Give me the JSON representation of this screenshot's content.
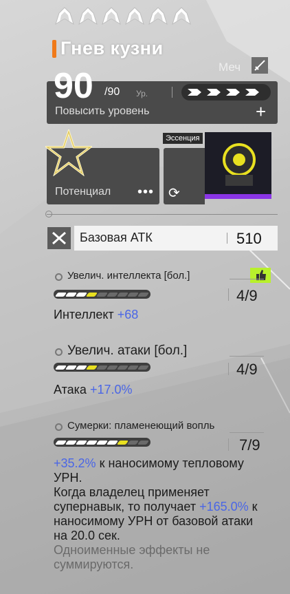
{
  "weapon": {
    "name": "Гнев кузни",
    "type": "Меч",
    "rarity_stars": 6,
    "level": "90",
    "level_max": "/90",
    "level_unit": "Ур.",
    "upgrade_label": "Повысить уровень",
    "potential_label": "Потенциал",
    "essence_label": "Эссенция",
    "base_atk_label": "Базовая АТК",
    "base_atk_value": "510"
  },
  "skills": [
    {
      "name": "Увелич. интеллекта [бол.]",
      "level": "4/9",
      "filled": 4,
      "total": 9,
      "stat_label": "Интеллект",
      "stat_value": "+68",
      "recommended": true
    },
    {
      "name": "Увелич. атаки [бол.]",
      "level": "4/9",
      "filled": 4,
      "total": 9,
      "stat_label": "Атака",
      "stat_value": "+17.0%",
      "recommended": false
    },
    {
      "name": "Сумерки: пламенеющий вопль",
      "level": "7/9",
      "filled": 7,
      "total": 9
    }
  ],
  "desc": {
    "v1": "+35.2%",
    "t1": " к наносимому тепловому УРН.",
    "t2": "Когда владелец применяет супернавык, то получает ",
    "v2": "+165.0%",
    "t3": " к наносимому УРН от базовой атаки на 20.0 сек.",
    "t4": "Одноименные эффекты не суммируются."
  },
  "colors": {
    "accent_orange": "#f07a1a",
    "stat_blue": "#4a66e6",
    "pip_filled": "#ffffff",
    "pip_latest": "#e8e020",
    "pip_empty": "#6a6a6a",
    "essence_purple": "#8a35e6",
    "recommend_green": "#b8f02c"
  }
}
